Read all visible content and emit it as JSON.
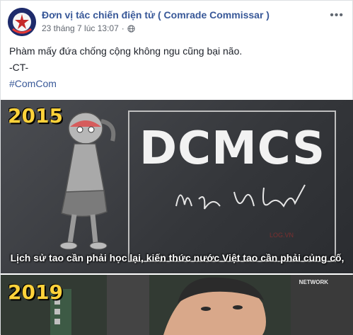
{
  "post": {
    "author": "Đơn vị tác chiến điện tử ( Comrade Commissar )",
    "timestamp": "23 tháng 7 lúc 13:07",
    "audience_icon": "globe-icon",
    "more_icon": "more-options-icon",
    "body_lines": [
      "Phàm mấy đứa chống cộng không ngu cũng bại não.",
      "-CT-"
    ],
    "hashtag": "#ComCom"
  },
  "image": {
    "panel1": {
      "year": "2015",
      "title": "DCMCS",
      "script": "Bí mật",
      "watermark": "LOG.VN",
      "subtitle": "Lịch sử tao cần phải học lại, kiến thức nước Việt tao cần phải củng cố,"
    },
    "panel2": {
      "year": "2019",
      "network_label": "NETWORK"
    }
  },
  "colors": {
    "link": "#385898",
    "year": "#ffd23a",
    "panel1_bg": "#3c3e42",
    "panel2_bg": "#2f3530"
  }
}
